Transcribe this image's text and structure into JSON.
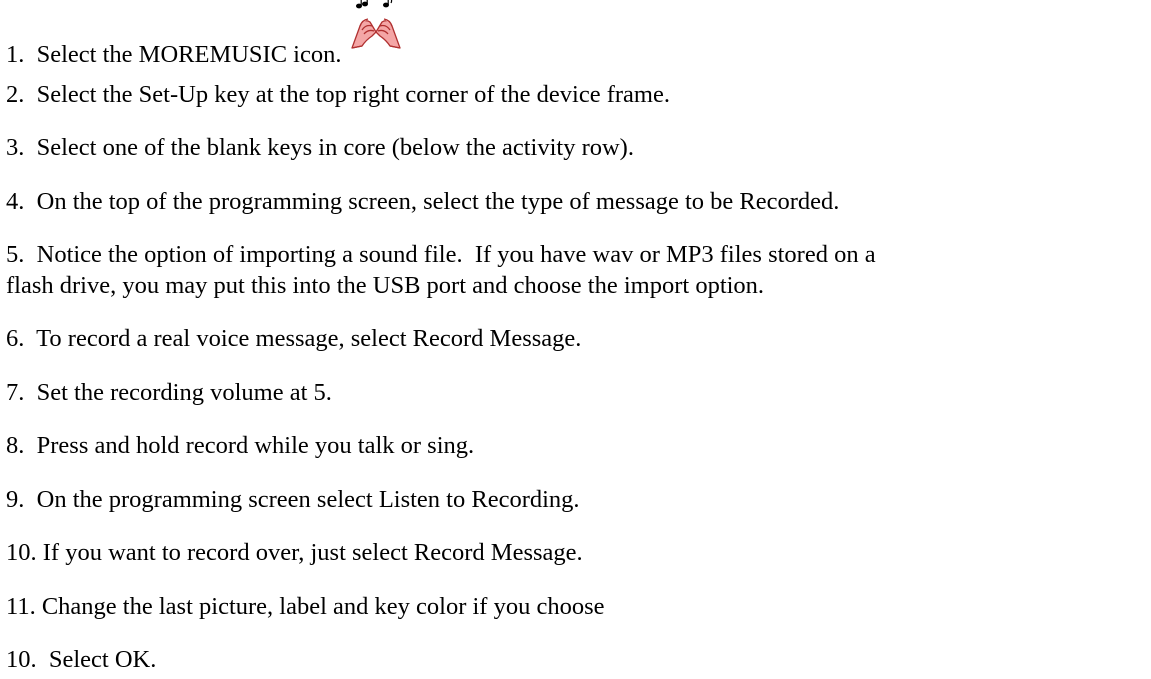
{
  "steps": [
    "1.  Select the MOREMUSIC icon.",
    "2.  Select the Set-Up key at the top right corner of the device frame.",
    "3.  Select one of the blank keys in core (below the activity row).",
    "4.  On the top of the programming screen, select the type of message to be Recorded.",
    "5.  Notice the option of importing a sound file.  If you have wav or MP3 files stored on a",
    "flash drive, you may put this into the USB port and choose the import option.",
    "6.  To record a real voice message, select Record Message.",
    "7.  Set the recording volume at 5.",
    "8.  Press and hold record while you talk or sing.",
    "9.  On the programming screen select Listen to Recording.",
    "10. If you want to record over, just select Record Message.",
    "11. Change the last picture, label and key color if you choose",
    "10.  Select OK."
  ],
  "icon": {
    "name": "moremusic-icon",
    "colors": {
      "hand_fill": "#f4a6a6",
      "hand_outline": "#b03030",
      "note": "#000000"
    }
  }
}
